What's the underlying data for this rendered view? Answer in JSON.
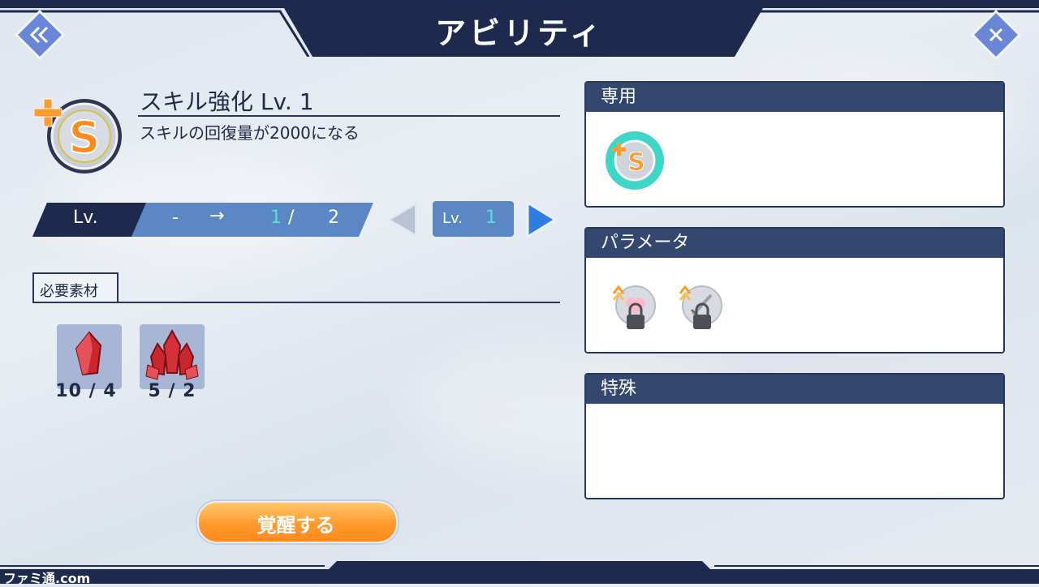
{
  "header": {
    "title": "アビリティ",
    "back_icon": "double-chevron-left-icon",
    "close_icon": "close-x-icon"
  },
  "skill": {
    "name": "スキル強化 Lv. 1",
    "description": "スキルの回復量が2000になる",
    "icon": "skill-plus-s-icon"
  },
  "level": {
    "label": "Lv.",
    "from": "-",
    "arrow": "→",
    "current": "1",
    "slash": "/",
    "max": "2",
    "selector_label": "Lv.",
    "selector_value": "1"
  },
  "materials": {
    "tab_label": "必要素材",
    "items": [
      {
        "icon": "red-crystal-icon",
        "count": "10 / 4"
      },
      {
        "icon": "red-crystal-cluster-icon",
        "count": "5 / 2"
      }
    ]
  },
  "awaken_button": {
    "label": "覚醒する"
  },
  "panels": {
    "exclusive": {
      "title": "専用"
    },
    "parameter": {
      "title": "パラメータ"
    },
    "special": {
      "title": "特殊"
    }
  },
  "watermark": "ファミ通.com",
  "colors": {
    "navy": "#1d2a4e",
    "panel_head": "#34486f",
    "accent_teal": "#4fe3d8",
    "button_orange": "#ff9a2e"
  }
}
